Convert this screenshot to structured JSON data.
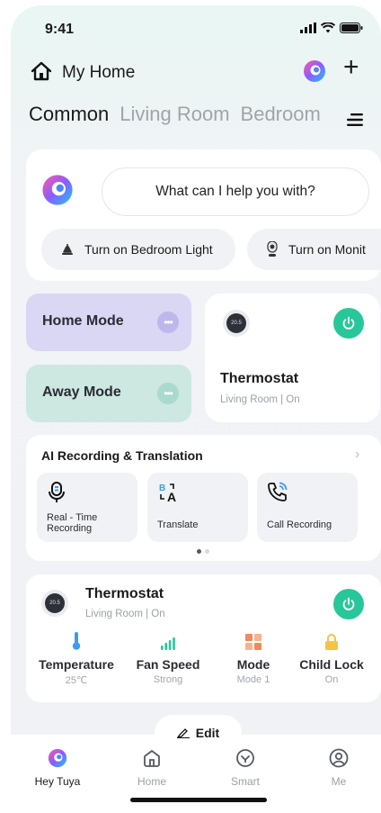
{
  "status_bar": {
    "time": "9:41"
  },
  "header": {
    "title": "My Home",
    "add_icon": "plus-icon",
    "home_icon": "house-icon"
  },
  "tabs": [
    {
      "label": "Common",
      "active": true
    },
    {
      "label": "Living Room",
      "active": false
    },
    {
      "label": "Bedroom",
      "active": false
    }
  ],
  "assistant": {
    "prompt": "What can I help you with?",
    "suggestions": [
      {
        "label": "Turn on Bedroom Light",
        "icon": "lamp-icon"
      },
      {
        "label": "Turn on Monit",
        "icon": "camera-icon"
      }
    ]
  },
  "modes": [
    {
      "label": "Home Mode",
      "color": "#d9d7f4"
    },
    {
      "label": "Away Mode",
      "color": "#cce8e1"
    }
  ],
  "thermostat_card": {
    "name": "Thermostat",
    "subtitle": "Living Room | On",
    "display": "20.5"
  },
  "ai_recording": {
    "title": "AI Recording & Translation",
    "tiles": [
      {
        "label_line1": "Real - Time",
        "label_line2": "Recording",
        "icon": "microphone-icon"
      },
      {
        "label_line1": "Translate",
        "label_line2": "",
        "icon": "translate-icon"
      },
      {
        "label_line1": "Call Recording",
        "label_line2": "",
        "icon": "phone-call-icon"
      }
    ],
    "pages": 2,
    "current_page": 1
  },
  "thermostat_detail": {
    "name": "Thermostat",
    "subtitle": "Living Room | On",
    "display": "20.5",
    "stats": [
      {
        "label": "Temperature",
        "value": "25℃",
        "icon": "thermometer-icon",
        "color": "#3b9bf5"
      },
      {
        "label": "Fan Speed",
        "value": "Strong",
        "icon": "signal-bars-icon",
        "color": "#27c79a"
      },
      {
        "label": "Mode",
        "value": "Mode 1",
        "icon": "grid-icon",
        "color": "#f08a5d"
      },
      {
        "label": "Child Lock",
        "value": "On",
        "icon": "lock-icon",
        "color": "#f6c344"
      }
    ]
  },
  "edit_label": "Edit",
  "tab_bar": [
    {
      "label": "Hey Tuya",
      "icon": "ai-logo-icon",
      "active": true
    },
    {
      "label": "Home",
      "icon": "home-icon",
      "active": false
    },
    {
      "label": "Smart",
      "icon": "smart-icon",
      "active": false
    },
    {
      "label": "Me",
      "icon": "user-icon",
      "active": false
    }
  ],
  "colors": {
    "accent_green": "#27c79a",
    "background": "#f1f2f5"
  }
}
